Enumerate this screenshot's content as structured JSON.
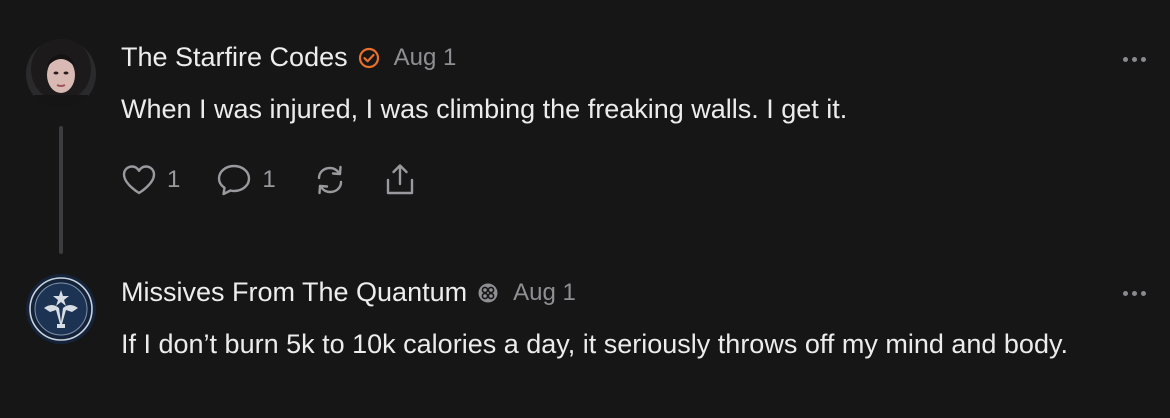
{
  "comments": [
    {
      "author": "The Starfire Codes",
      "date": "Aug 1",
      "text": "When I was injured, I was climbing the freaking walls. I get it.",
      "likes": "1",
      "replies": "1",
      "badge_icon": "check-circle-icon",
      "badge_color": "#e8702a"
    },
    {
      "author": "Missives From The Quantum",
      "date": "Aug 1",
      "text": "If I don’t burn 5k to 10k calories a day, it seriously throws off my mind and body.",
      "badge_icon": "substack-badge-icon",
      "badge_color": "#8f8f93"
    }
  ],
  "colors": {
    "background": "#161617",
    "text": "#ececec",
    "muted": "#8f8f93",
    "icon": "#9a9a9e"
  }
}
